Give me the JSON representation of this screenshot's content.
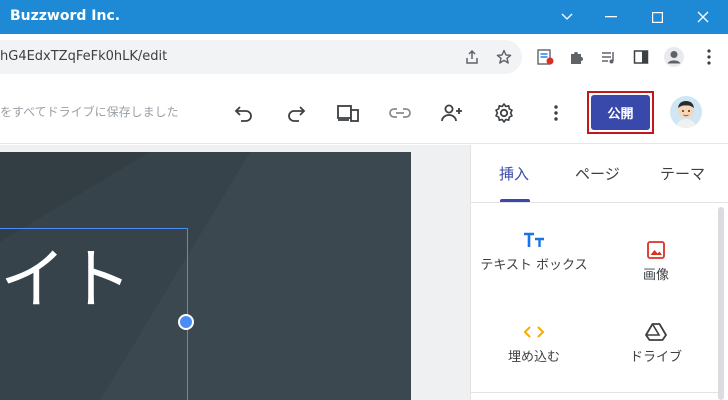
{
  "window": {
    "title": "Buzzword Inc.",
    "minimize_icon": "minimize-icon",
    "maximize_icon": "maximize-icon",
    "close_icon": "close-icon",
    "chevron_icon": "chevron-down-icon",
    "accent": "#1e8ad6"
  },
  "browser": {
    "url": "hG4EdxTZqFeFk0hLK/edit"
  },
  "editor": {
    "save_status": "をすべてドライブに保存しました",
    "publish_label": "公開",
    "publish_color": "#3949ab",
    "highlight_color": "#c4161c"
  },
  "slide": {
    "title": "イト"
  },
  "panel": {
    "tabs": [
      {
        "label": "挿入",
        "active": true
      },
      {
        "label": "ページ",
        "active": false
      },
      {
        "label": "テーマ",
        "active": false
      }
    ],
    "items": [
      {
        "label": "テキスト ボックス",
        "icon": "text-box-icon"
      },
      {
        "label": "画像",
        "icon": "image-icon"
      },
      {
        "label": "埋め込む",
        "icon": "embed-icon"
      },
      {
        "label": "ドライブ",
        "icon": "drive-icon"
      }
    ]
  }
}
